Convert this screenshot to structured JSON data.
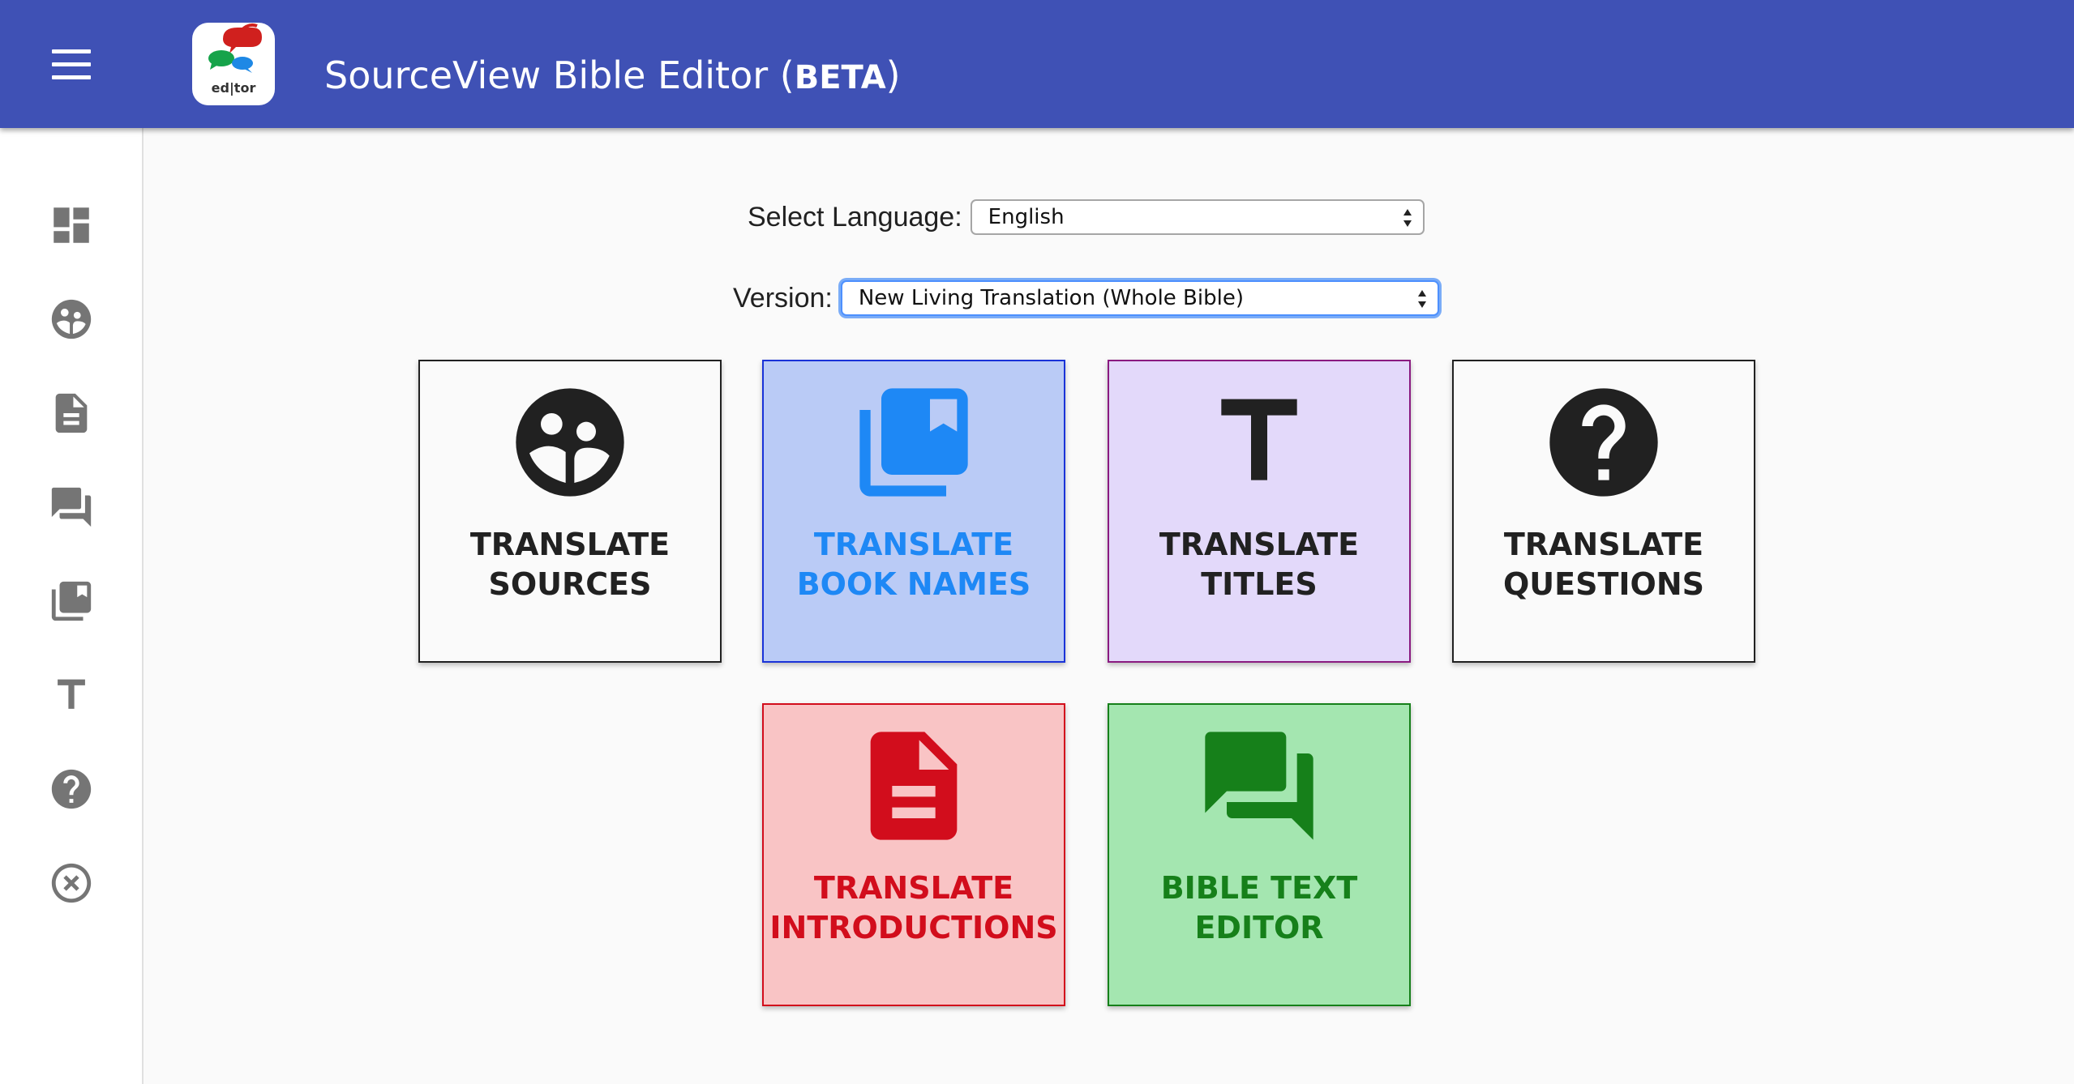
{
  "app": {
    "title": "SourceView Bible Editor (",
    "beta": "BETA",
    "title_end": ")",
    "logo_text": "ed|tor",
    "accent_color": "#3f51b5"
  },
  "sidebar": {
    "items": [
      {
        "icon": "dashboard-icon"
      },
      {
        "icon": "translate-sources-icon"
      },
      {
        "icon": "document-icon"
      },
      {
        "icon": "forum-icon"
      },
      {
        "icon": "library-books-icon"
      },
      {
        "icon": "title-icon"
      },
      {
        "icon": "help-icon"
      },
      {
        "icon": "close-circle-icon"
      }
    ]
  },
  "form": {
    "language_label": "Select Language:",
    "language_value": "English",
    "version_label": "Version:",
    "version_value": "New Living Translation (Whole Bible)"
  },
  "tiles": [
    {
      "label": "TRANSLATE\nSOURCES",
      "icon": "translate-sources-icon",
      "color": "#212121"
    },
    {
      "label": "TRANSLATE\nBOOK NAMES",
      "icon": "library-books-icon",
      "color": "#1e88f5"
    },
    {
      "label": "TRANSLATE\nTITLES",
      "icon": "title-icon",
      "color": "#212121"
    },
    {
      "label": "TRANSLATE\nQUESTIONS",
      "icon": "help-icon",
      "color": "#212121"
    },
    {
      "label": "TRANSLATE\nINTRODUCTIONS",
      "icon": "document-icon",
      "color": "#d20d1c"
    },
    {
      "label": "BIBLE TEXT\nEDITOR",
      "icon": "forum-icon",
      "color": "#16801a"
    }
  ]
}
